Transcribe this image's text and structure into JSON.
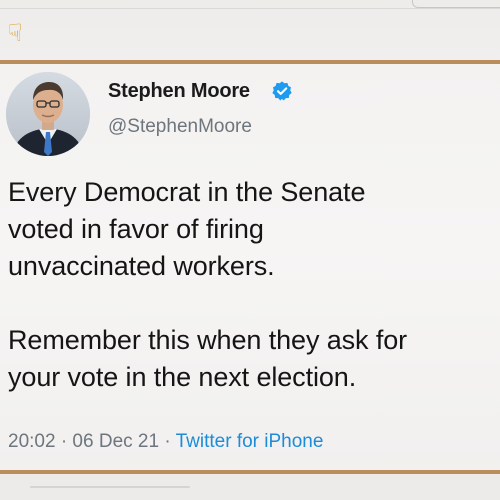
{
  "tweet": {
    "display_name": "Stephen Moore",
    "handle": "@StephenMoore",
    "verified": true,
    "avatar_icon": "profile-photo",
    "text_lines": [
      "Every Democrat in the Senate",
      "voted in favor of firing",
      "unvaccinated workers.",
      "",
      "Remember this when they ask for",
      "your vote in the next election."
    ],
    "timestamp": "20:02 · 06 Dec 21",
    "separator": "·",
    "source": "Twitter for iPhone"
  },
  "previous_tweet": {
    "emoji_icon": "pointing-hand-emoji"
  },
  "colors": {
    "frame": "#b98d5c",
    "verified_badge": "#1d9bf0",
    "link": "#1d8cd8",
    "secondary_text": "#6e767d"
  }
}
